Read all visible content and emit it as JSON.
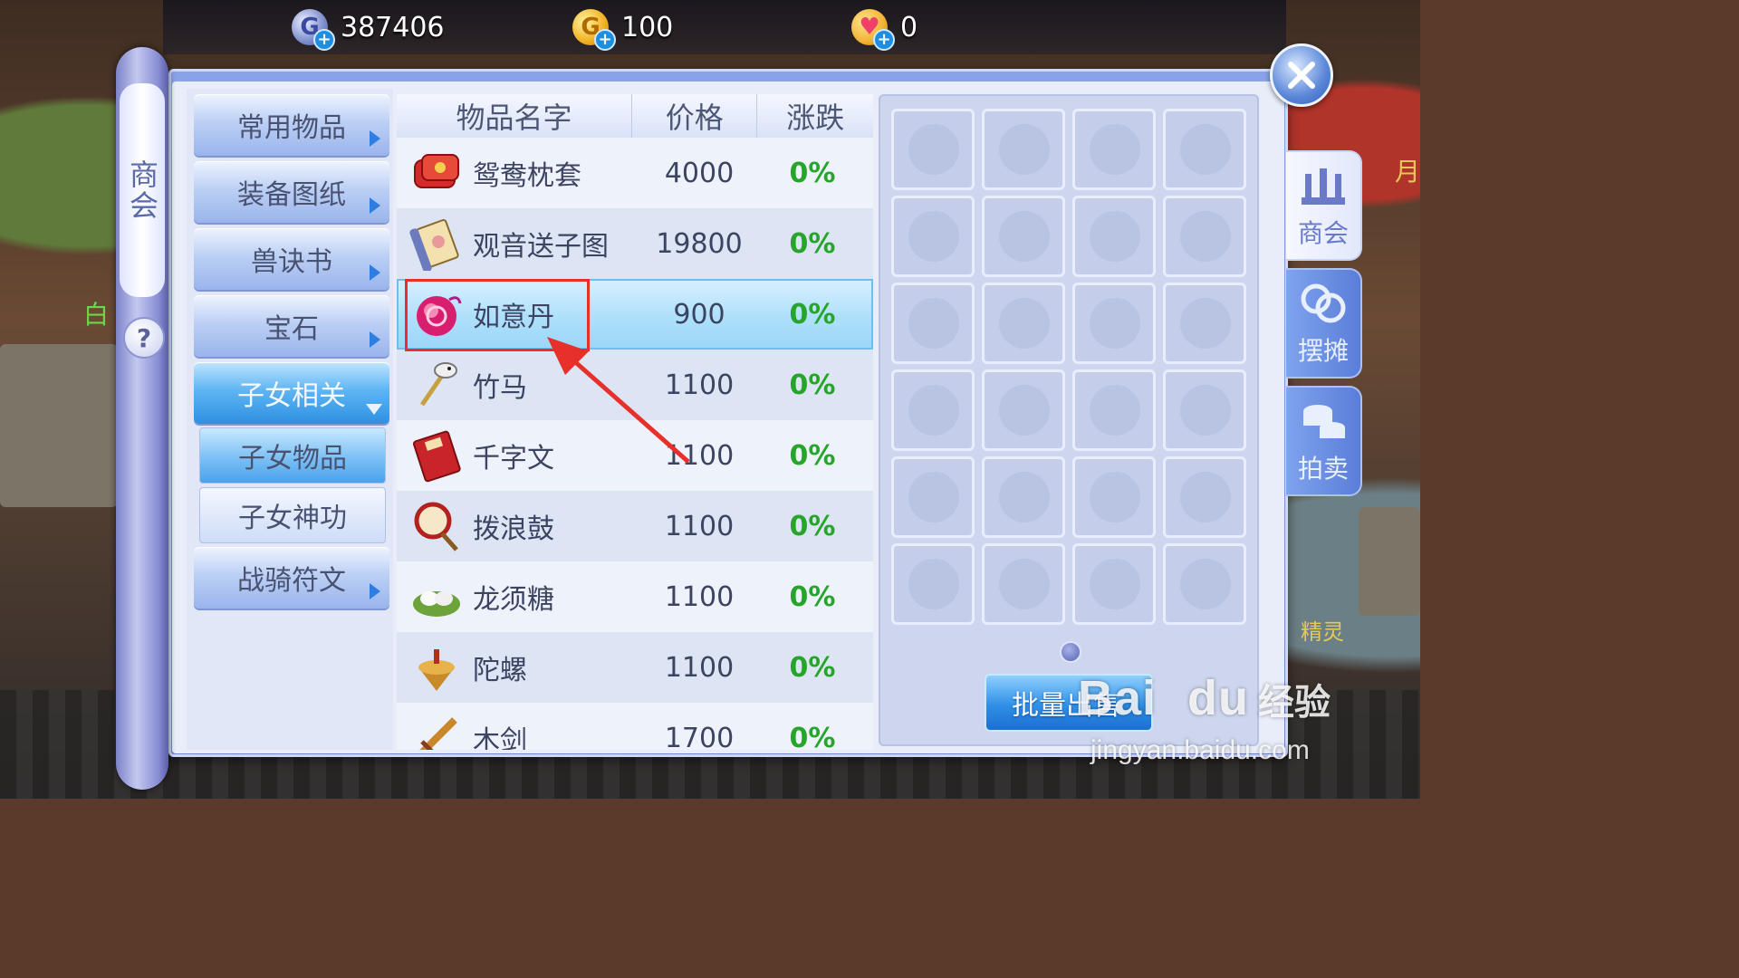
{
  "currency": {
    "silver": {
      "value": "387406",
      "glyph": "G"
    },
    "gold": {
      "value": "100",
      "glyph": "G"
    },
    "hearts": {
      "value": "0",
      "glyph": "♥"
    }
  },
  "scroll": {
    "label": "商会",
    "help": "?"
  },
  "categories": [
    {
      "label": "常用物品"
    },
    {
      "label": "装备图纸"
    },
    {
      "label": "兽诀书"
    },
    {
      "label": "宝石"
    },
    {
      "label": "子女相关"
    },
    {
      "label": "子女物品"
    },
    {
      "label": "子女神功"
    },
    {
      "label": "战骑符文"
    }
  ],
  "table": {
    "headers": {
      "name": "物品名字",
      "price": "价格",
      "change": "涨跌"
    },
    "rows": [
      {
        "name": "鸳鸯枕套",
        "price": "4000",
        "change": "0%",
        "icon": "pillow-icon"
      },
      {
        "name": "观音送子图",
        "price": "19800",
        "change": "0%",
        "icon": "scroll-painting-icon"
      },
      {
        "name": "如意丹",
        "price": "900",
        "change": "0%",
        "icon": "pill-icon"
      },
      {
        "name": "竹马",
        "price": "1100",
        "change": "0%",
        "icon": "hobby-horse-icon"
      },
      {
        "name": "千字文",
        "price": "1100",
        "change": "0%",
        "icon": "book-icon"
      },
      {
        "name": "拨浪鼓",
        "price": "1100",
        "change": "0%",
        "icon": "rattle-drum-icon"
      },
      {
        "name": "龙须糖",
        "price": "1100",
        "change": "0%",
        "icon": "candy-icon"
      },
      {
        "name": "陀螺",
        "price": "1100",
        "change": "0%",
        "icon": "spinning-top-icon"
      },
      {
        "name": "木剑",
        "price": "1700",
        "change": "0%",
        "icon": "wooden-sword-icon"
      }
    ]
  },
  "inventory": {
    "bulk_sell_label": "批量出售"
  },
  "side_tabs": [
    {
      "label": "商会",
      "icon": "pillars-icon"
    },
    {
      "label": "摆摊",
      "icon": "coins-icon"
    },
    {
      "label": "拍卖",
      "icon": "coin-stack-icon"
    }
  ],
  "background_labels": {
    "left": "白",
    "right_top": "月",
    "right_bottom": "精灵"
  },
  "watermark": {
    "brand": "Bai",
    "brand2": "du",
    "cn": "经验",
    "url": "jingyan.baidu.com"
  },
  "colors": {
    "accent": "#2e8fe2",
    "change_green": "#27a52b",
    "annotation_red": "#e8302a"
  }
}
